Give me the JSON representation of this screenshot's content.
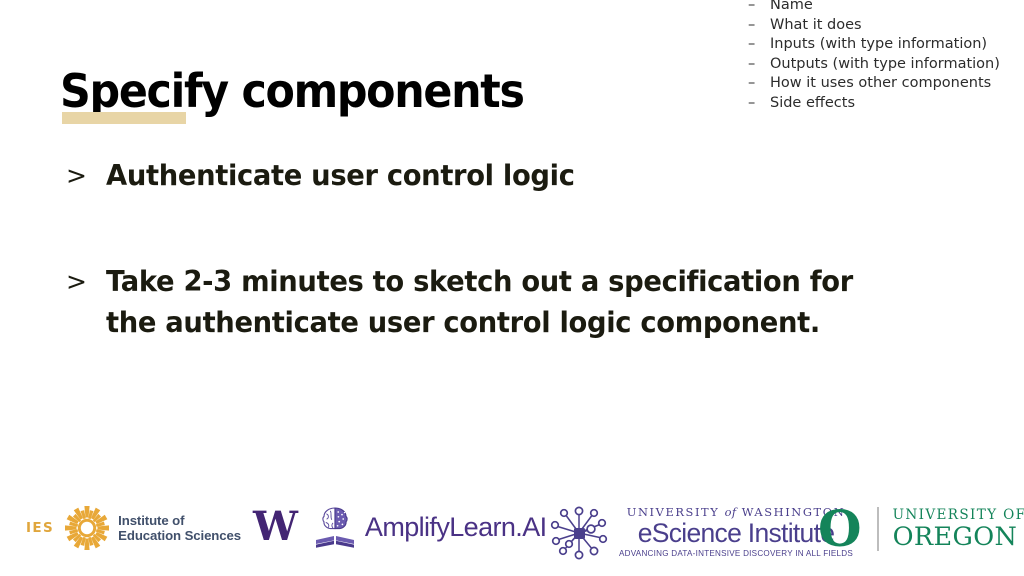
{
  "slide": {
    "background_color": "#ffffff",
    "title": "Specify components",
    "title_color": "#000000",
    "title_underline_color": "#e8d5a6"
  },
  "spec_list": {
    "marker": "–",
    "items": [
      "Name",
      "What it does",
      "Inputs (with type information)",
      "Outputs (with type information)",
      "How it uses other components",
      "Side effects"
    ]
  },
  "bullets": {
    "marker": ">",
    "items": [
      {
        "lines": [
          "Authenticate user control logic"
        ]
      },
      {
        "lines": [
          "Take 2-3 minutes to sketch out a specification for",
          "the authenticate user control logic component."
        ]
      }
    ]
  },
  "footer": {
    "logos": {
      "ies": {
        "acronym": "IES",
        "line1": "Institute of",
        "line2": "Education Sciences",
        "mark_color": "#e0a63c",
        "text_color": "#41506b"
      },
      "amplify": {
        "w": "W",
        "wordmark": "AmplifyLearn.AI",
        "w_color": "#432573",
        "text_color": "#4a3285"
      },
      "escience": {
        "university_pre": "UNIVERSITY ",
        "university_of": "of",
        "university_post": " WASHINGTON",
        "name": "eScience Institute",
        "tagline": "ADVANCING DATA-INTENSIVE DISCOVERY IN ALL FIELDS",
        "color": "#4a3f8c"
      },
      "oregon": {
        "mark": "O",
        "line1": "UNIVERSITY OF",
        "line2": "OREGON",
        "color": "#14845a"
      }
    }
  }
}
